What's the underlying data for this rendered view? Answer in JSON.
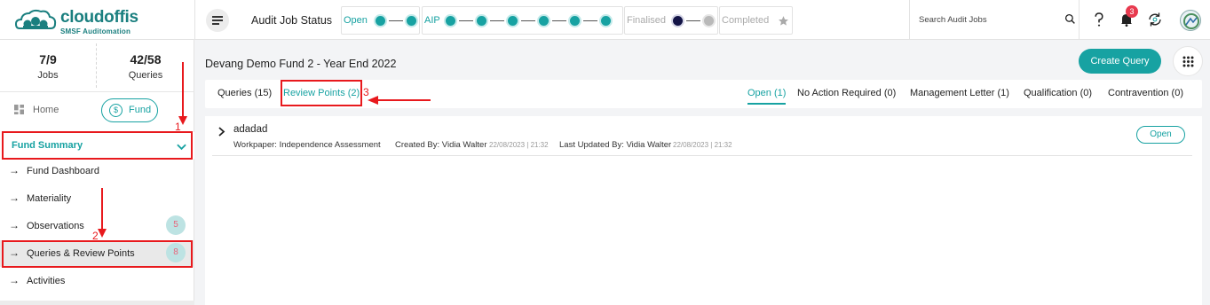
{
  "brand": {
    "name": "cloudoffis",
    "tagline": "SMSF Auditomation"
  },
  "header": {
    "audit_title": "Audit Job Status",
    "stages": [
      {
        "label": "Open",
        "color": "#17a2a2"
      },
      {
        "label": "AIP",
        "color": "#17a2a2"
      },
      {
        "label": "Finalised",
        "color": "#aaaaaa"
      },
      {
        "label": "Completed",
        "color": "#aaaaaa"
      }
    ],
    "search_placeholder": "Search Audit Jobs",
    "notification_count": "3"
  },
  "sidebar": {
    "stats": [
      {
        "value": "7/9",
        "label": "Jobs"
      },
      {
        "value": "42/58",
        "label": "Queries"
      }
    ],
    "home_label": "Home",
    "fund_label": "Fund",
    "section_title": "Fund Summary",
    "items": [
      {
        "label": "Fund Dashboard"
      },
      {
        "label": "Materiality"
      },
      {
        "label": "Observations",
        "badge": "5"
      },
      {
        "label": "Queries & Review Points",
        "badge": "8"
      },
      {
        "label": "Activities"
      }
    ]
  },
  "main": {
    "page_title": "Devang Demo Fund 2 - Year End 2022",
    "create_button": "Create Query",
    "tabs_left": [
      {
        "label": "Queries (15)"
      },
      {
        "label": "Review Points (2)",
        "active": true
      }
    ],
    "tabs_right": [
      {
        "label": "Open (1)",
        "active": true
      },
      {
        "label": "No Action Required (0)"
      },
      {
        "label": "Management Letter (1)"
      },
      {
        "label": "Qualification (0)"
      },
      {
        "label": "Contravention (0)"
      }
    ],
    "review_point": {
      "title": "adadad",
      "workpaper": "Workpaper: Independence Assessment",
      "created_by_label": "Created By: Vidia Walter",
      "created_at": "22/08/2023 | 21:32",
      "updated_by_label": "Last Updated By: Vidia Walter",
      "updated_at": "22/08/2023 | 21:32",
      "status": "Open"
    }
  },
  "annotations": {
    "markers": [
      "1",
      "2",
      "3"
    ],
    "color": "#e8191d"
  },
  "colors": {
    "accent": "#17a2a2",
    "badge_bg": "#bde3e3",
    "badge_text": "#e8657b",
    "notification": "#e83a4f"
  }
}
